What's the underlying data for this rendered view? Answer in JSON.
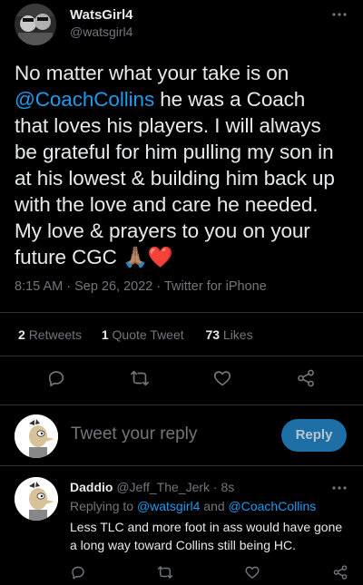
{
  "tweet": {
    "author_name": "WatsGirl4",
    "author_handle": "@watsgirl4",
    "lines": [
      {
        "text": "No matter what your take is on"
      },
      {
        "mention": "@CoachCollins",
        "text": " he was a Coach"
      },
      {
        "text": "that loves his players. I will always"
      },
      {
        "text": "be grateful for him pulling my son in"
      },
      {
        "text": "at his lowest & building him back up"
      },
      {
        "text": "with the love and care he needed."
      },
      {
        "text": "My love & prayers to you on your"
      },
      {
        "text": "future CGC",
        "emoji": "🙏🏽❤️"
      }
    ],
    "timestamp": "8:15 AM · Sep 26, 2022 · Twitter for iPhone",
    "stats": {
      "retweets_count": "2",
      "retweets_label": "Retweets",
      "quotes_count": "1",
      "quotes_label": "Quote Tweet",
      "likes_count": "73",
      "likes_label": "Likes"
    }
  },
  "icons": {
    "more": "more-icon",
    "reply": "reply-icon",
    "retweet": "retweet-icon",
    "like": "like-icon",
    "share": "share-icon"
  },
  "composer": {
    "placeholder": "Tweet your reply",
    "button_label": "Reply"
  },
  "reply": {
    "author_name": "Daddio",
    "author_handle": "@Jeff_The_Jerk",
    "time": "· 8s",
    "replying_prefix": "Replying to ",
    "replying_user1": "@watsgirl4",
    "replying_and": " and ",
    "replying_user2": "@CoachCollins",
    "text_lines": [
      "Less TLC and more foot in ass would have gone",
      "a long way toward Collins still being HC."
    ]
  },
  "colors": {
    "background": "#000000",
    "text": "#e7e9ea",
    "muted": "#71767b",
    "accent": "#1d9bf0",
    "reply_button": "#1d6fa5",
    "divider": "#2f3336"
  }
}
